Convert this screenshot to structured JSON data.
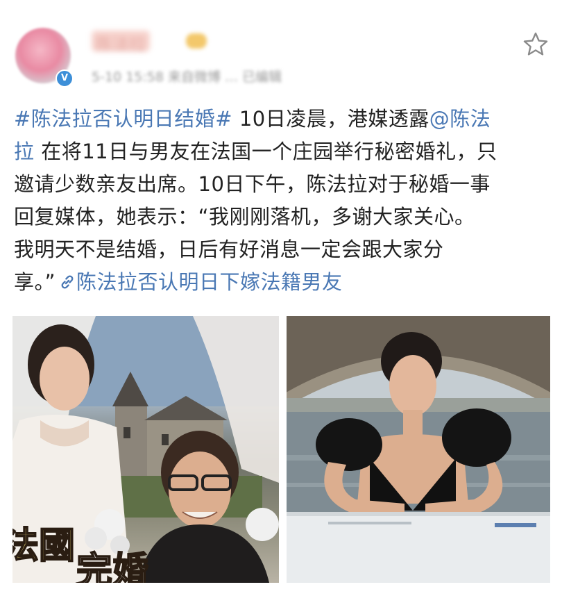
{
  "user": {
    "name": "陈法拉",
    "verified_badge": "V",
    "meta": "5-10 15:58 来自微博 … 已编辑"
  },
  "icons": {
    "star": "star-icon",
    "link": "link-icon"
  },
  "post": {
    "tag": "#陈法拉否认明日结婚#",
    "line1_rest": " 10日凌晨，港媒透露",
    "mention_a": "@陈法",
    "mention_b": "拉",
    "line2_rest": " 在将11日与男友在法国一个庄园举行秘密婚礼，只",
    "line3": "邀请少数亲友出席。10日下午，陈法拉对于秘婚一事",
    "line4": "回复媒体，她表示：“我刚刚落机，多谢大家关心。",
    "line5": "我明天不是结婚，日后有好消息一定会跟大家分",
    "line6_start": "享。”",
    "link_text": "陈法拉否认明日下嫁法籍男友"
  },
  "photos": {
    "photo1_caption_a": "法國",
    "photo1_caption_b": "完婚"
  },
  "colors": {
    "link_blue": "#4a78b4",
    "text": "#222222",
    "meta_gray": "#9a9a9a"
  }
}
